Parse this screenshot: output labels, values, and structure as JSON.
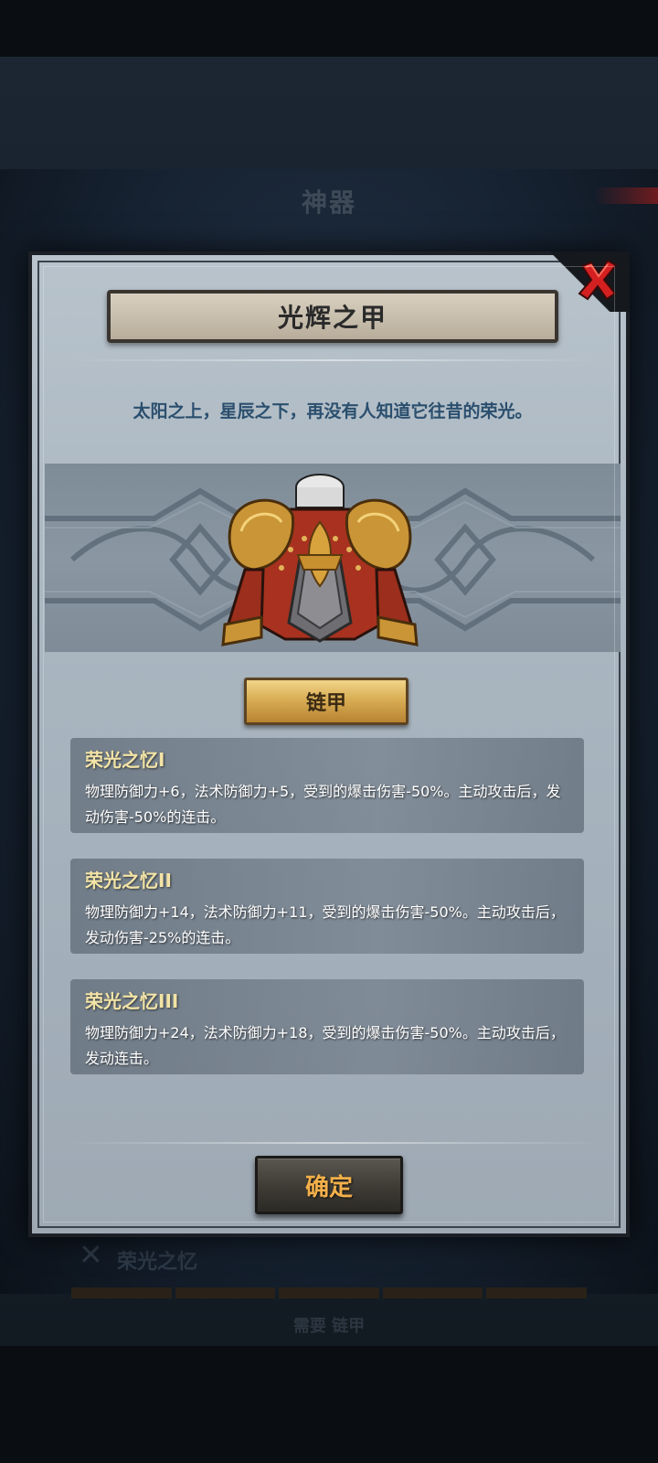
{
  "background": {
    "title": "神器",
    "section_title": "荣光之忆",
    "bottom_text": "需要 链甲"
  },
  "dialog": {
    "title": "光辉之甲",
    "description": "太阳之上，星辰之下，再没有人知道它往昔的荣光。",
    "item_icon": "crimson-gold-armor-icon",
    "type_label": "链甲",
    "skills": [
      {
        "name": "荣光之忆I",
        "desc": "物理防御力+6，法术防御力+5，受到的爆击伤害-50%。主动攻击后，发动伤害-50%的连击。"
      },
      {
        "name": "荣光之忆II",
        "desc": "物理防御力+14，法术防御力+11，受到的爆击伤害-50%。主动攻击后，发动伤害-25%的连击。"
      },
      {
        "name": "荣光之忆III",
        "desc": "物理防御力+24，法术防御力+18，受到的爆击伤害-50%。主动攻击后，发动连击。"
      }
    ],
    "confirm_label": "确定",
    "close_icon": "close-x-icon"
  },
  "colors": {
    "title_banner": "#c9bfae",
    "subtitle_text": "#2b4f6e",
    "skill_name": "#f2e3a6",
    "type_button": "#d9ae55",
    "confirm_text": "#f3b04a",
    "close_x": "#d42020"
  }
}
